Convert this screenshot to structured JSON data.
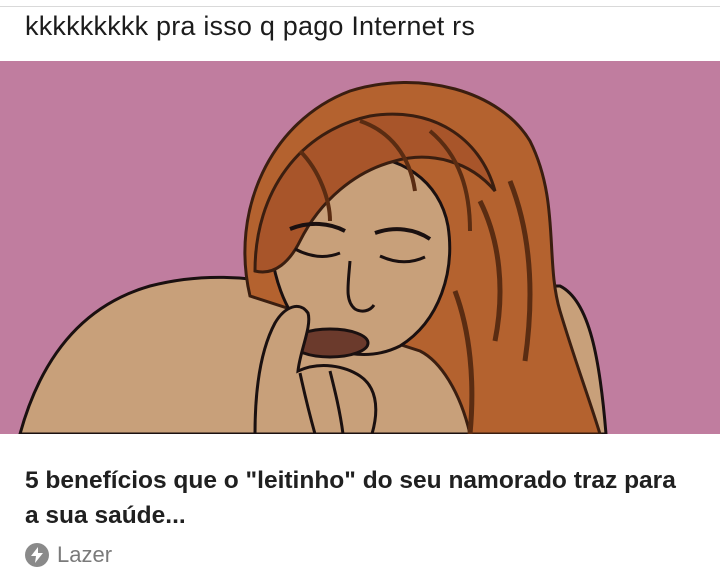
{
  "post": {
    "caption": "kkkkkkkkk pra isso q pago Internet rs"
  },
  "card": {
    "headline": "5 benefícios que o \"leitinho\" do seu namorado traz para a sua saúde...",
    "source_label": "Lazer",
    "source_icon": "lightning-bolt-icon"
  },
  "colors": {
    "hero_background": "#c07d9f",
    "skin": "#c8a07a",
    "hair": "#b4622f",
    "source_icon": "#8a8a8a"
  }
}
